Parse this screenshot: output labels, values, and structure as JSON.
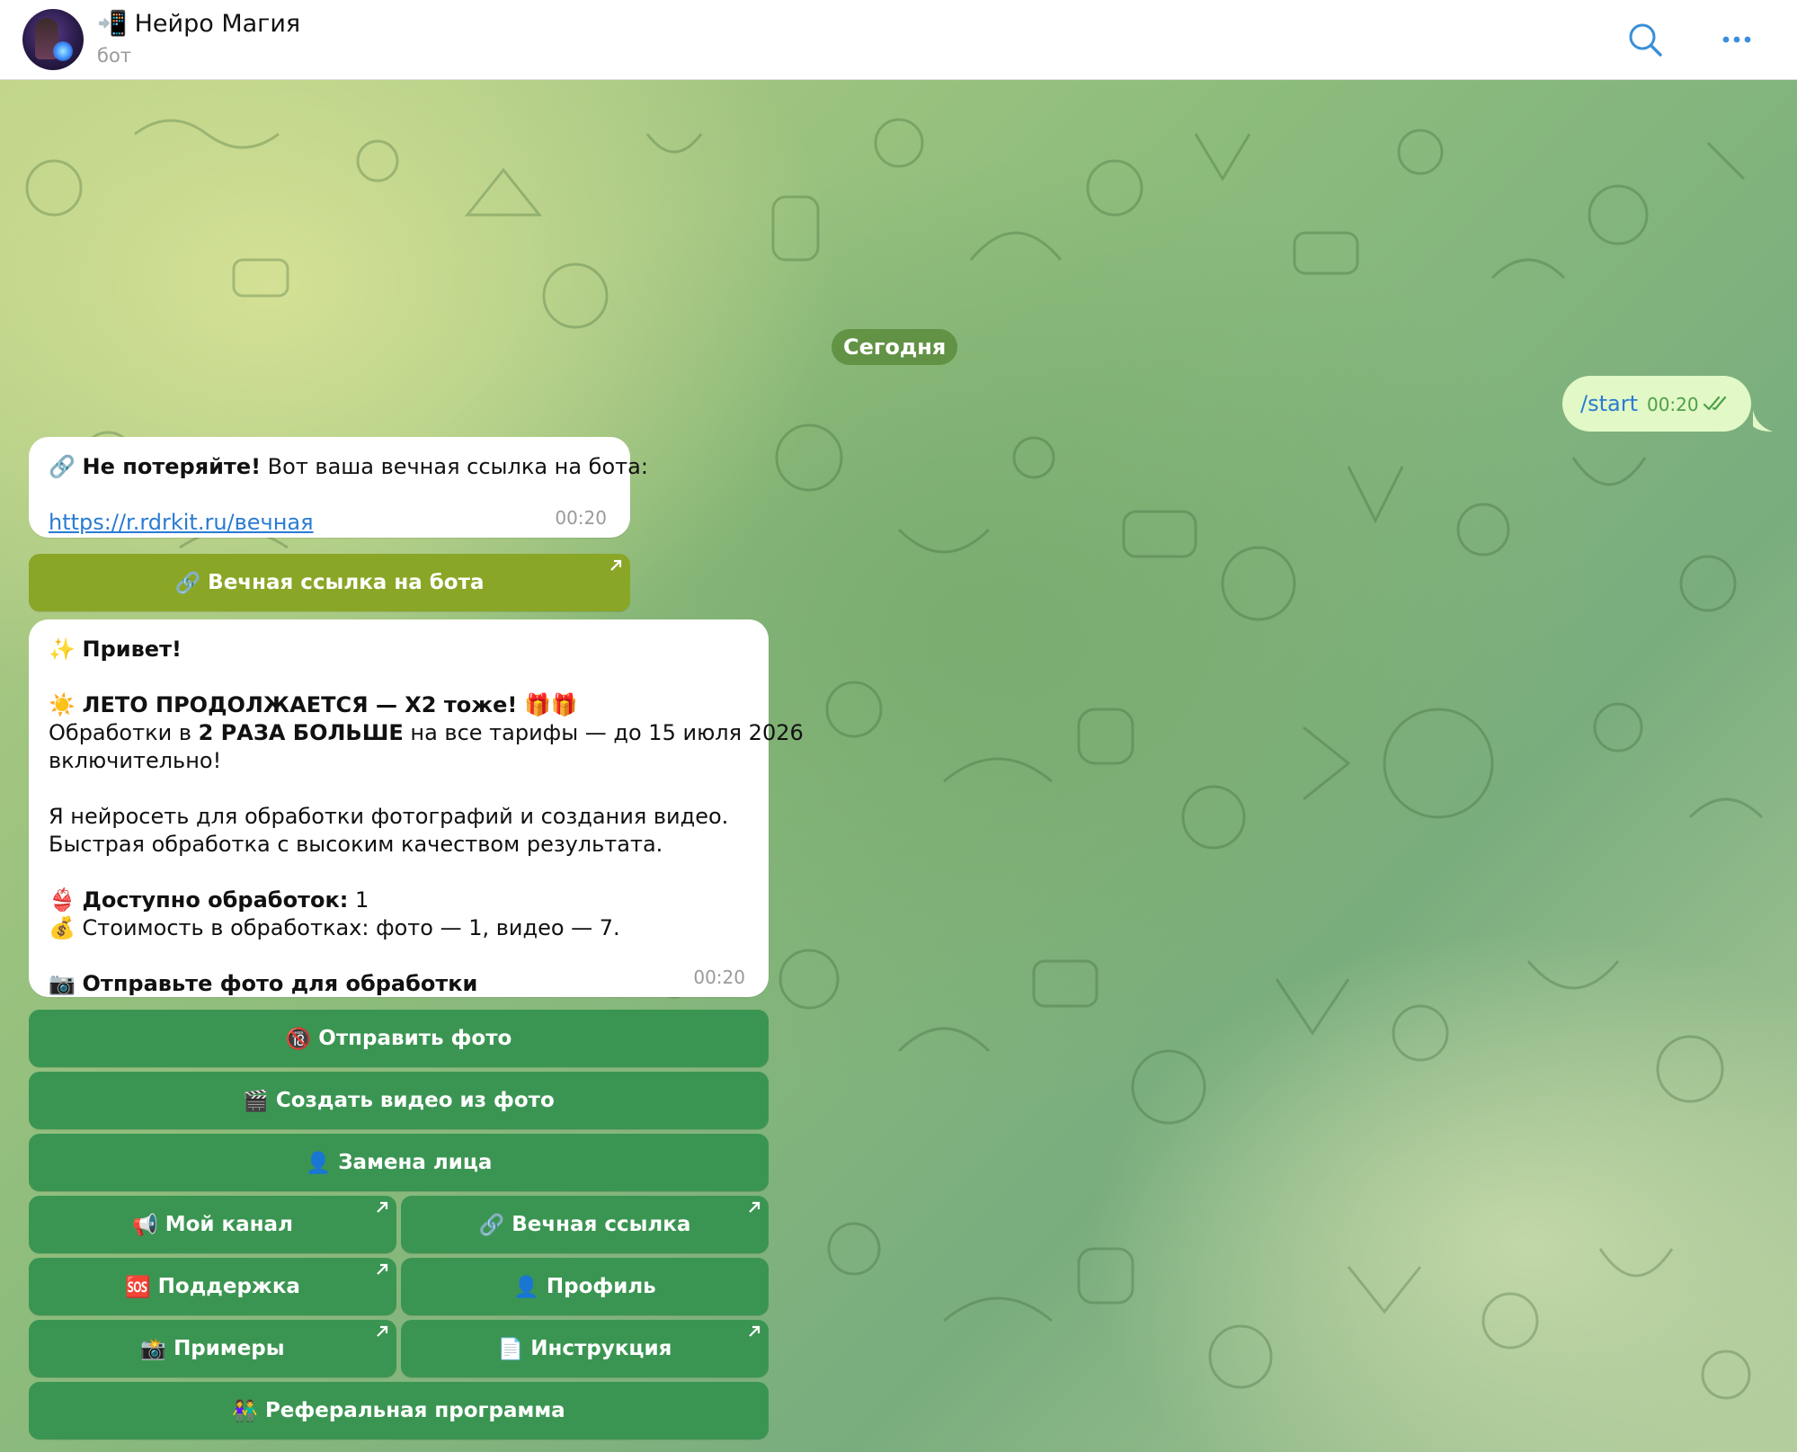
{
  "header": {
    "title": "Нейро Магия",
    "title_emoji": "📲",
    "subtitle": "бот",
    "icons": [
      "search-icon",
      "more-icon"
    ]
  },
  "chat": {
    "date_label": "Сегодня",
    "outgoing": {
      "text": "/start",
      "time": "00:20",
      "status": "read"
    },
    "message1": {
      "emoji": "🔗",
      "bold": "Не потеряйте!",
      "text": " Вот ваша вечная ссылка на бота:",
      "link": "https://r.rdrkit.ru/вечная",
      "time": "00:20"
    },
    "message1_button": {
      "emoji": "🔗",
      "label": "Вечная ссылка на бота",
      "external": true
    },
    "message2": {
      "greeting_emoji": "✨",
      "greeting": "Привет!",
      "promo_emoji": "☀️",
      "promo_title": "ЛЕТО ПРОДОЛЖАЕТСЯ — X2 тоже!",
      "promo_gifts": "🎁🎁",
      "line1_before": "Обработки в ",
      "line1_bold": "2 РАЗА БОЛЬШЕ",
      "line1_after": " на все тарифы — до 15 июля 2026",
      "line2": "включительно!",
      "desc1": "Я нейросеть для обработки фотографий и создания видео.",
      "desc2": "Быстрая обработка с высоким качеством результата.",
      "avail_emoji": "👙",
      "avail_label": "Доступно обработок:",
      "avail_value": " 1",
      "cost_emoji": "💰",
      "cost_text": "Стоимость в обработках: фото — 1, видео — 7.",
      "cta_emoji": "📷",
      "cta": "Отправьте фото для обработки",
      "time": "00:20"
    },
    "keyboard": [
      {
        "emoji": "🔞",
        "label": "Отправить фото",
        "external": false
      },
      {
        "emoji": "🎬",
        "label": "Создать видео из фото",
        "external": false
      },
      {
        "emoji": "👤",
        "label": "Замена лица",
        "external": false
      },
      {
        "emoji": "📢",
        "label": "Мой канал",
        "external": true
      },
      {
        "emoji": "🔗",
        "label": "Вечная ссылка",
        "external": true
      },
      {
        "emoji": "🆘",
        "label": "Поддержка",
        "external": true
      },
      {
        "emoji": "👤",
        "label": "Профиль",
        "external": false
      },
      {
        "emoji": "📸",
        "label": "Примеры",
        "external": true
      },
      {
        "emoji": "📄",
        "label": "Инструкция",
        "external": true
      },
      {
        "emoji": "👫",
        "label": "Реферальная программа",
        "external": false
      }
    ]
  },
  "colors": {
    "button_green": "#3b9552",
    "button_olive": "#8aa626",
    "outgoing_bubble": "#e2f8c6",
    "link": "#2a7bd3",
    "date_pill": "#5c8c3c"
  }
}
